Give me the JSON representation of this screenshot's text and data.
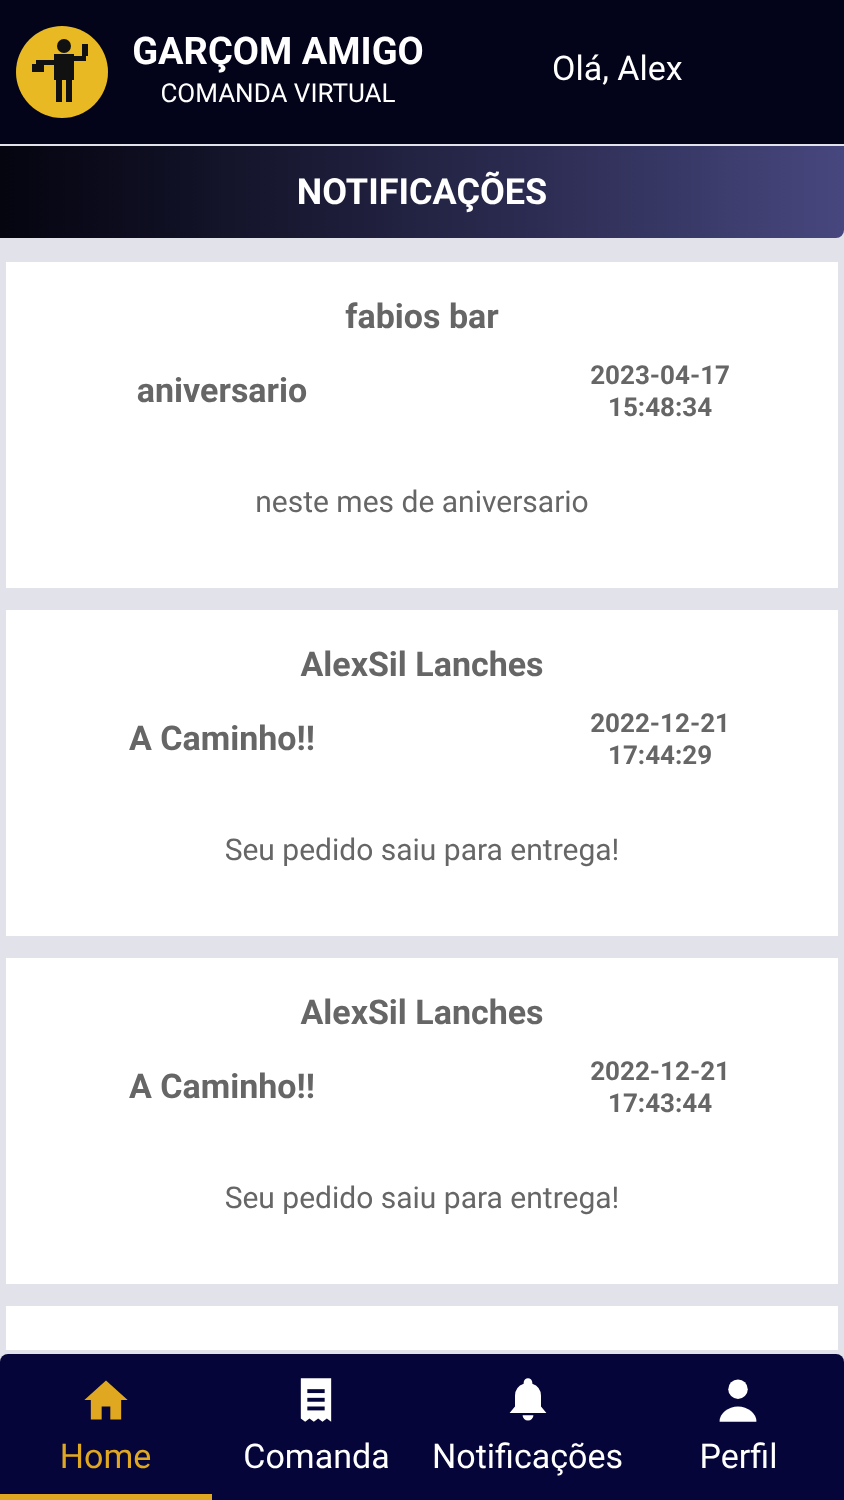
{
  "header": {
    "app_name": "GARÇOM AMIGO",
    "subtitle": "COMANDA VIRTUAL",
    "greeting": "Olá, Alex"
  },
  "page_title": "NOTIFICAÇÕES",
  "notifications": [
    {
      "store": "fabios bar",
      "subject": "aniversario",
      "date": "2023-04-17",
      "time": "15:48:34",
      "message": "neste mes de aniversario"
    },
    {
      "store": "AlexSil Lanches",
      "subject": "A Caminho!!",
      "date": "2022-12-21",
      "time": "17:44:29",
      "message": "Seu pedido saiu para entrega!"
    },
    {
      "store": "AlexSil Lanches",
      "subject": "A Caminho!!",
      "date": "2022-12-21",
      "time": "17:43:44",
      "message": "Seu pedido saiu para entrega!"
    }
  ],
  "bottom_nav": [
    {
      "kind": "home",
      "label": "Home",
      "selected": true
    },
    {
      "kind": "receipt",
      "label": "Comanda",
      "selected": false
    },
    {
      "kind": "bell",
      "label": "Notificações",
      "selected": false
    },
    {
      "kind": "user",
      "label": "Perfil",
      "selected": false
    }
  ]
}
